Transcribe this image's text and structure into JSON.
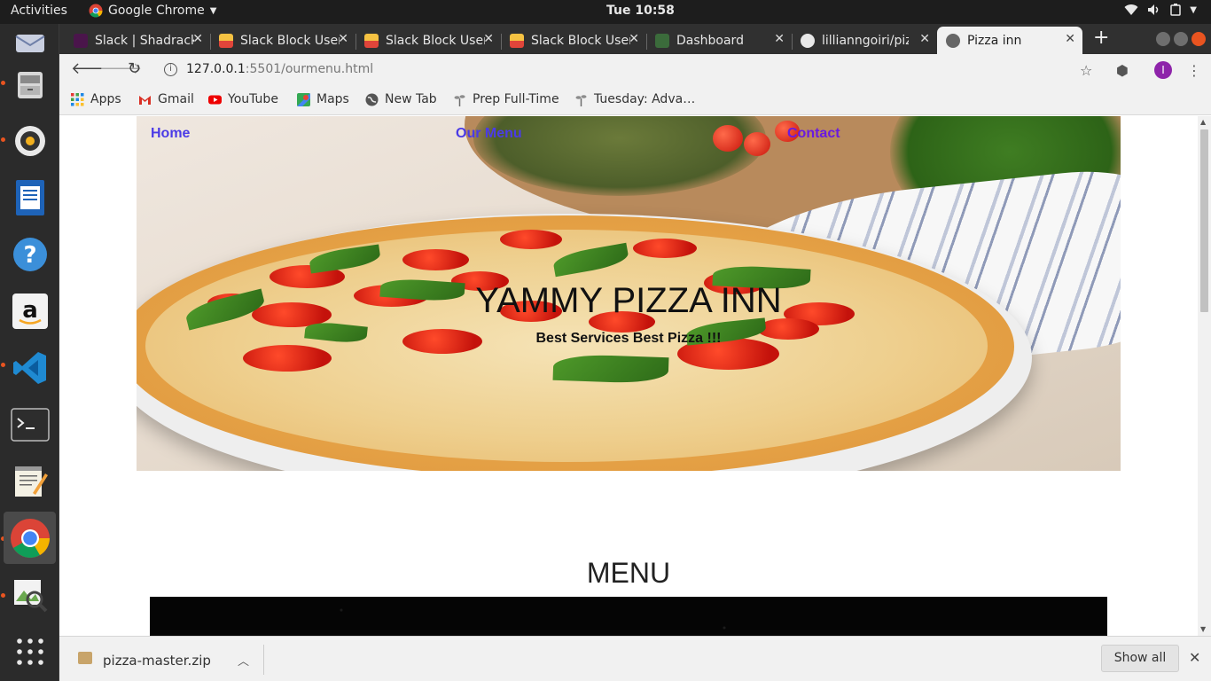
{
  "topbar": {
    "activities": "Activities",
    "app_name": "Google Chrome",
    "clock": "Tue 10:58"
  },
  "dock": {
    "items": [
      "thunderbird",
      "files",
      "rhythmbox",
      "libreoffice-writer",
      "help",
      "amazon",
      "vscode",
      "terminal",
      "text-editor",
      "chrome",
      "image-viewer",
      "show-applications"
    ]
  },
  "tabs": [
    {
      "label": "Slack | Shadrack",
      "icon": "slack-icon",
      "color": "#4a154b"
    },
    {
      "label": "Slack Block User",
      "icon": "block-icon",
      "color": "#f5c242"
    },
    {
      "label": "Slack Block User",
      "icon": "block-icon",
      "color": "#f5c242"
    },
    {
      "label": "Slack Block User",
      "icon": "block-icon",
      "color": "#f5c242"
    },
    {
      "label": "Dashboard",
      "icon": "dashboard-icon",
      "color": "#3b6b3b"
    },
    {
      "label": "lillianngoiri/pizza",
      "icon": "github-icon",
      "color": "#e8e8e8"
    },
    {
      "label": "Pizza inn",
      "icon": "globe-icon",
      "color": "#555555"
    }
  ],
  "toolbar": {
    "url_host": "127.0.0.1",
    "url_rest": ":5501/ourmenu.html",
    "profile_initial": "I"
  },
  "bookmarks": [
    {
      "label": "Apps",
      "icon": "apps-grid-icon"
    },
    {
      "label": "Gmail",
      "icon": "gmail-icon"
    },
    {
      "label": "YouTube",
      "icon": "youtube-icon"
    },
    {
      "label": "Maps",
      "icon": "maps-icon"
    },
    {
      "label": "New Tab",
      "icon": "globe-icon"
    },
    {
      "label": "Prep Full-Time",
      "icon": "sprout-icon"
    },
    {
      "label": "Tuesday: Adva…",
      "icon": "sprout-icon"
    }
  ],
  "page": {
    "nav": {
      "home": "Home",
      "menu": "Our Menu",
      "contact": "Contact"
    },
    "hero_title": "YAMMY PIZZA INN",
    "hero_subtitle": "Best Services Best Pizza !!!",
    "menu_heading": "MENU"
  },
  "colors": {
    "nav_link": "#4b3be6",
    "nav_visited": "#6a1ae0",
    "accent": "#e95420"
  },
  "downloads": {
    "file": "pizza-master.zip",
    "show_all": "Show all"
  }
}
